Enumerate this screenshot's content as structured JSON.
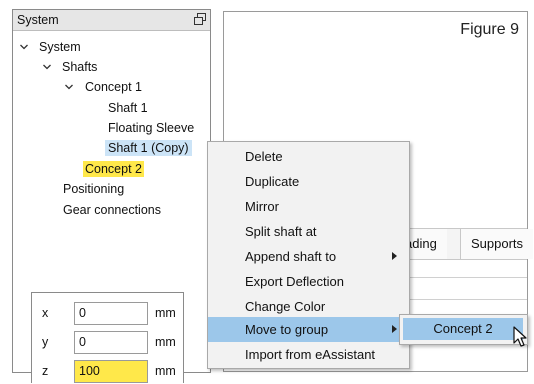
{
  "system_panel": {
    "title": "System",
    "float_icon": "float-window-icon",
    "tree": {
      "system": "System",
      "shafts": "Shafts",
      "concept1": "Concept 1",
      "shaft1": "Shaft 1",
      "floating_sleeve": "Floating Sleeve",
      "shaft1_copy": "Shaft 1 (Copy)",
      "concept2": "Concept 2",
      "positioning": "Positioning",
      "gear_connections": "Gear connections"
    }
  },
  "right_panel": {
    "figure_label": "Figure 9",
    "tabs": [
      "ading",
      "Supports"
    ]
  },
  "context_menu": {
    "items": [
      {
        "label": "Delete"
      },
      {
        "label": "Duplicate"
      },
      {
        "label": "Mirror"
      },
      {
        "label": "Split shaft at"
      },
      {
        "label": "Append shaft to",
        "submenu": true
      },
      {
        "label": "Export Deflection"
      },
      {
        "label": "Change Color"
      },
      {
        "label": "Move to group",
        "submenu": true,
        "active": true
      },
      {
        "label": "Import from eAssistant"
      }
    ],
    "submenu_item": "Concept 2"
  },
  "coordinates": {
    "x": {
      "label": "x",
      "value": "0",
      "unit": "mm"
    },
    "y": {
      "label": "y",
      "value": "0",
      "unit": "mm"
    },
    "z": {
      "label": "z",
      "value": "100",
      "unit": "mm"
    }
  },
  "colors": {
    "highlight": "#ffe84a",
    "menu_active": "#9cc7ea",
    "tree_selected": "#cce4f7"
  }
}
